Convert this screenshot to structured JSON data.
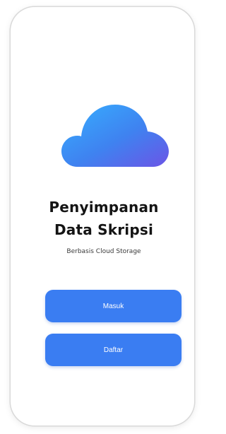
{
  "app": {
    "title_line1": "Penyimpanan",
    "title_line2": "Data Skripsi",
    "subtitle": "Berbasis Cloud Storage"
  },
  "actions": {
    "login_label": "Masuk",
    "register_label": "Daftar"
  },
  "icons": {
    "hero": "cloud-icon"
  },
  "colors": {
    "button": "#3a7df2",
    "cloud_gradient": [
      "#35a7ff",
      "#3f7ff0",
      "#6a5ce8"
    ],
    "title": "#141414"
  }
}
